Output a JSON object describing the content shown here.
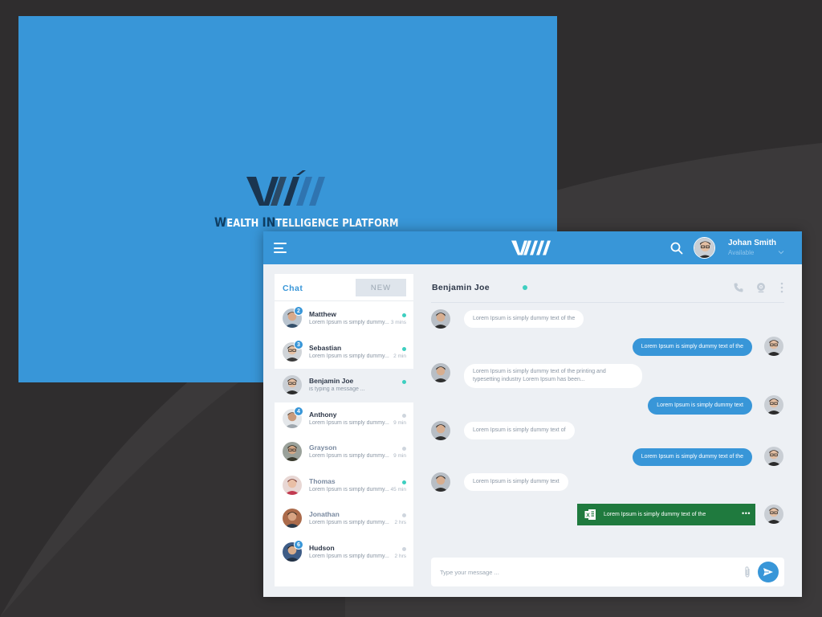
{
  "splash": {
    "tagline_parts": [
      {
        "text": "W",
        "dark": true
      },
      {
        "text": "EALTH ",
        "dark": false
      },
      {
        "text": "IN",
        "dark": true
      },
      {
        "text": "TELLIGENCE PLATFORM",
        "dark": false
      }
    ],
    "logo_text": "WIN"
  },
  "header": {
    "logo_text": "WIN",
    "user_name": "Johan Smith",
    "user_status": "Available"
  },
  "sidebar": {
    "title": "Chat",
    "new_label": "NEW",
    "contacts": [
      {
        "name": "Matthew",
        "preview": "Lorem Ipsum is simply dummy...",
        "time": "3 mins",
        "badge": "2",
        "online": true,
        "active": false,
        "muted": false
      },
      {
        "name": "Sebastian",
        "preview": "Lorem Ipsum is simply dummy...",
        "time": "2 min",
        "badge": "3",
        "online": true,
        "active": false,
        "muted": false
      },
      {
        "name": "Benjamin Joe",
        "preview": "is typing a message ...",
        "time": "",
        "badge": "",
        "online": true,
        "active": true,
        "muted": false
      },
      {
        "name": "Anthony",
        "preview": "Lorem Ipsum is simply dummy...",
        "time": "9 min",
        "badge": "4",
        "online": false,
        "active": false,
        "muted": false
      },
      {
        "name": "Grayson",
        "preview": "Lorem Ipsum is simply dummy...",
        "time": "9 min",
        "badge": "",
        "online": false,
        "active": false,
        "muted": true
      },
      {
        "name": "Thomas",
        "preview": "Lorem Ipsum is simply dummy...",
        "time": "45 min",
        "badge": "",
        "online": true,
        "active": false,
        "muted": true
      },
      {
        "name": "Jonathan",
        "preview": "Lorem Ipsum is simply dummy...",
        "time": "2 hrs",
        "badge": "",
        "online": false,
        "active": false,
        "muted": true
      },
      {
        "name": "Hudson",
        "preview": "Lorem Ipsum is simply dummy...",
        "time": "2 hrs",
        "badge": "6",
        "online": false,
        "active": false,
        "muted": false
      }
    ]
  },
  "chat": {
    "contact_name": "Benjamin Joe",
    "messages": [
      {
        "dir": "in",
        "text": "Lorem Ipsum is simply dummy text of the"
      },
      {
        "dir": "out",
        "text": "Lorem Ipsum is simply dummy text of the"
      },
      {
        "dir": "in",
        "text": "Lorem Ipsum is simply dummy text of  the printing and typesetting industry Lorem Ipsum has been..."
      },
      {
        "dir": "out",
        "text": "Lorem Ipsum is simply dummy text"
      },
      {
        "dir": "in",
        "text": "Lorem Ipsum is simply dummy text of"
      },
      {
        "dir": "out",
        "text": "Lorem Ipsum is simply dummy text of the"
      },
      {
        "dir": "in",
        "text": "Lorem Ipsum is simply dummy text"
      },
      {
        "dir": "file",
        "text": "Lorem Ipsum is simply dummy text of the",
        "more": "•••"
      }
    ],
    "composer_placeholder": "Type your message ..."
  },
  "colors": {
    "brand_blue": "#3896d8",
    "brand_dark": "#0f3e63",
    "online": "#3ecfc0",
    "file_green": "#1f7a3e"
  },
  "icons": [
    "menu-icon",
    "search-icon",
    "chevron-down-icon",
    "phone-icon",
    "webcam-icon",
    "more-vertical-icon",
    "paperclip-icon",
    "send-icon",
    "excel-icon"
  ]
}
